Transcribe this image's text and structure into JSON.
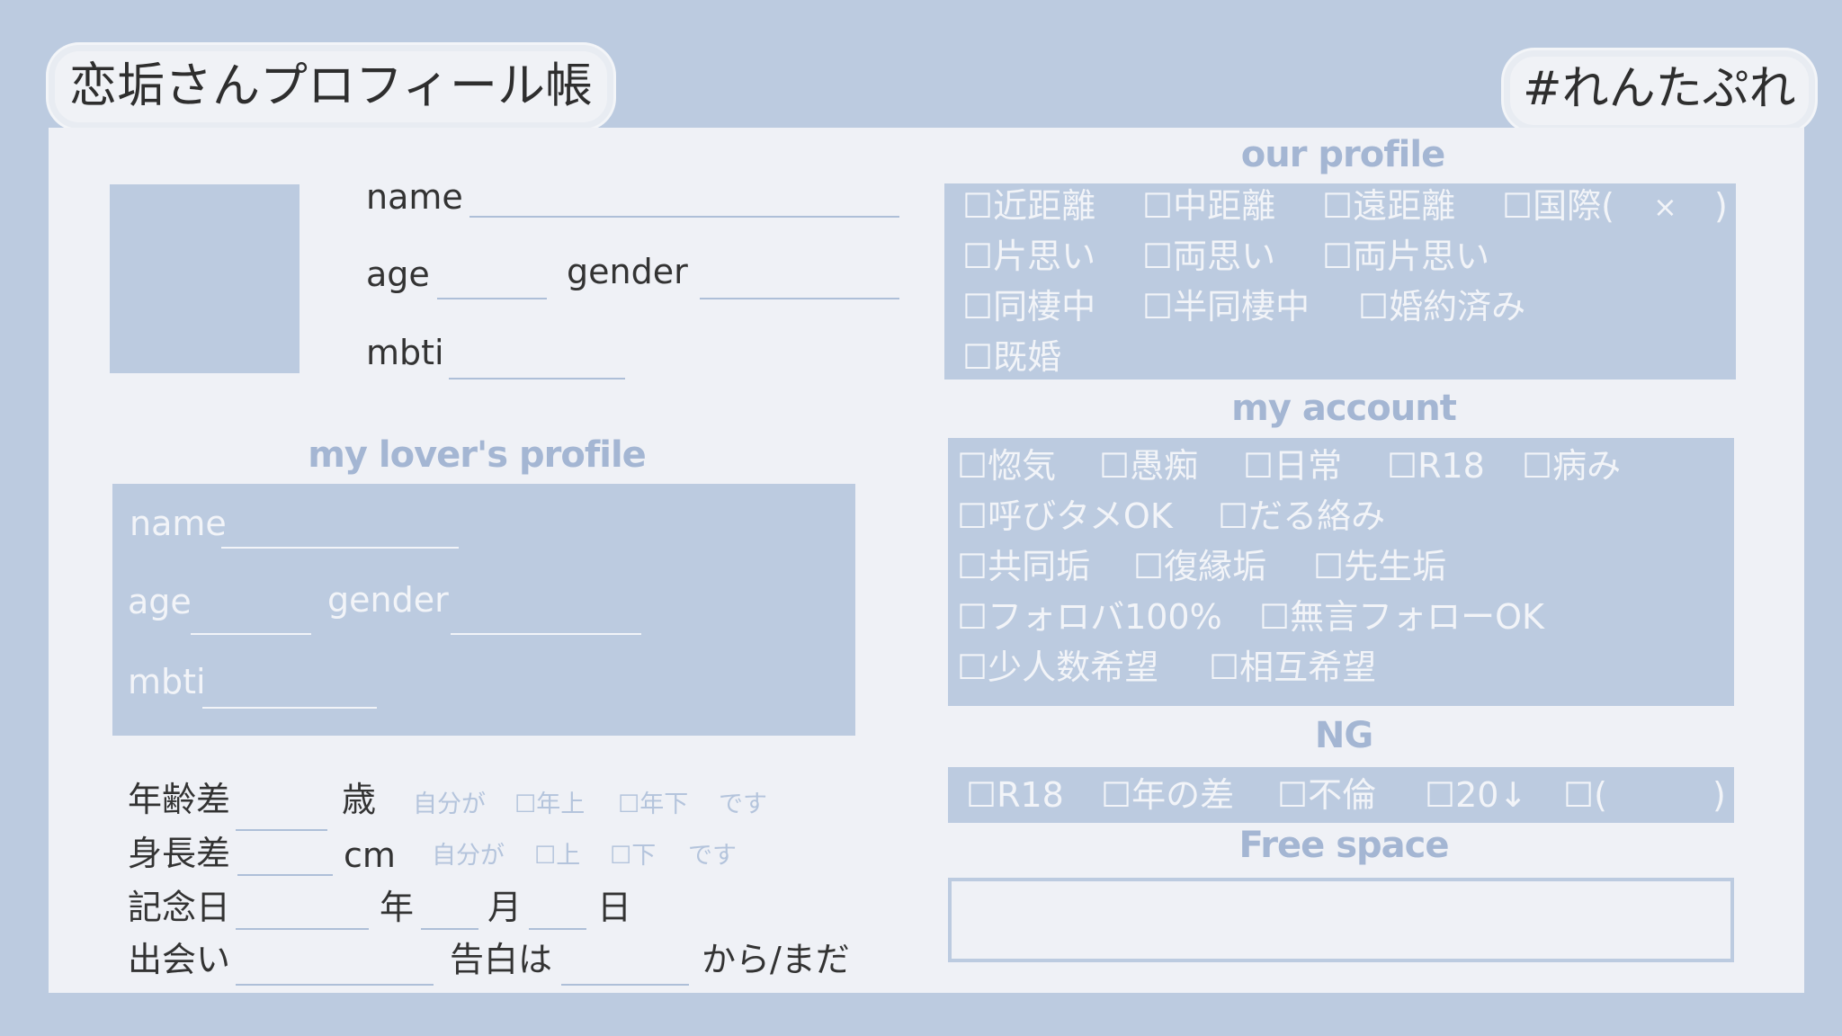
{
  "title": "恋垢さんプロフィール帳",
  "hashtag": "#れんたぷれ",
  "self": {
    "name_label": "name",
    "age_label": "age",
    "gender_label": "gender",
    "mbti_label": "mbti"
  },
  "lover": {
    "heading": "my lover's profile",
    "name_label": "name",
    "age_label": "age",
    "gender_label": "gender",
    "mbti_label": "mbti"
  },
  "details": {
    "age_diff": {
      "label": "年齢差",
      "unit": "歳",
      "self": "自分が",
      "opt1": "☐年上",
      "opt2": "☐年下",
      "suffix": "です"
    },
    "height_diff": {
      "label": "身長差",
      "unit": "cm",
      "self": "自分が",
      "opt1": "☐上",
      "opt2": "☐下",
      "suffix": "です"
    },
    "anniversary": {
      "label": "記念日",
      "year": "年",
      "month": "月",
      "day": "日"
    },
    "meeting": {
      "label": "出会い",
      "confess": "告白は",
      "suffix": "から/まだ"
    }
  },
  "our_profile": {
    "heading": "our profile",
    "rows": [
      [
        "☐近距離",
        "☐中距離",
        "☐遠距離",
        "☐国際(",
        "×",
        ")"
      ],
      [
        "☐片思い",
        "☐両思い",
        "☐両片思い"
      ],
      [
        "☐同棲中",
        "☐半同棲中",
        "☐婚約済み"
      ],
      [
        "☐既婚"
      ]
    ]
  },
  "my_account": {
    "heading": "my account",
    "rows": [
      [
        "☐惚気",
        "☐愚痴",
        "☐日常",
        "☐R18",
        "☐病み"
      ],
      [
        "☐呼びタメOK",
        "☐だる絡み"
      ],
      [
        "☐共同垢",
        "☐復縁垢",
        "☐先生垢"
      ],
      [
        "☐フォロバ100%",
        "☐無言フォローOK"
      ],
      [
        "☐少人数希望",
        "☐相互希望"
      ]
    ]
  },
  "ng": {
    "heading": "NG",
    "items": [
      "☐R18",
      "☐年の差",
      "☐不倫",
      "☐20↓",
      "☐(",
      ")"
    ]
  },
  "free_space": {
    "heading": "Free space"
  }
}
